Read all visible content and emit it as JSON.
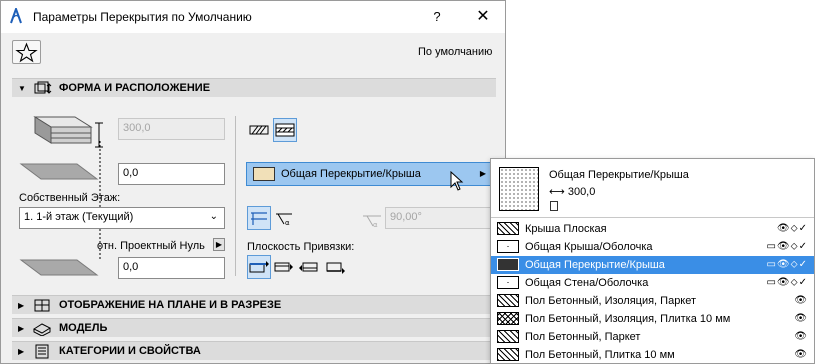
{
  "window": {
    "title": "Параметры Перекрытия по Умолчанию",
    "help_label": "?",
    "close_label": "✕"
  },
  "toolbar": {
    "favorites_icon": "star-icon",
    "default_label": "По умолчанию"
  },
  "sections": {
    "shape": {
      "title": "ФОРМА И РАСПОЛОЖЕНИЕ",
      "expanded": true
    },
    "floorplan": {
      "title": "ОТОБРАЖЕНИЕ НА ПЛАНЕ И В РАЗРЕЗЕ",
      "expanded": false
    },
    "model": {
      "title": "МОДЕЛЬ",
      "expanded": false
    },
    "categories": {
      "title": "КАТЕГОРИИ И СВОЙСТВА",
      "expanded": false
    }
  },
  "geometry": {
    "thickness_value": "300,0",
    "offset_value": "0,0",
    "home_story_label": "Собственный Этаж:",
    "home_story_value": "1. 1-й этаж (Текущий)",
    "project_zero_label": "отн. Проектный Нуль",
    "project_zero_value": "0,0",
    "angle_value": "90,00°",
    "ref_plane_label": "Плоскость Привязки:"
  },
  "composite": {
    "selected": "Общая Перекрытие/Крыша",
    "swatch_color": "#f1e0b8"
  },
  "dropdown": {
    "preview_name": "Общая Перекрытие/Крыша",
    "preview_thickness": "300,0",
    "items": [
      {
        "name": "Крыша Плоская",
        "flags": "👁⬦✓",
        "pattern": "diag",
        "selected": false
      },
      {
        "name": "Общая Крыша/Оболочка",
        "flags": "▭👁⬦✓",
        "pattern": "dots",
        "selected": false
      },
      {
        "name": "Общая Перекрытие/Крыша",
        "flags": "▭👁⬦✓",
        "pattern": "dark",
        "selected": true
      },
      {
        "name": "Общая Стена/Оболочка",
        "flags": "▭👁⬦✓",
        "pattern": "dots",
        "selected": false
      },
      {
        "name": "Пол Бетонный, Изоляция, Паркет",
        "flags": "👁",
        "pattern": "diag",
        "selected": false
      },
      {
        "name": "Пол Бетонный, Изоляция, Плитка 10 мм",
        "flags": "👁",
        "pattern": "cross",
        "selected": false
      },
      {
        "name": "Пол Бетонный, Паркет",
        "flags": "👁",
        "pattern": "diag",
        "selected": false
      },
      {
        "name": "Пол Бетонный, Плитка 10 мм",
        "flags": "👁",
        "pattern": "diag",
        "selected": false
      }
    ]
  },
  "colors": {
    "accent": "#3a8ee6",
    "composite_bg": "#9cc7f0",
    "header_bg": "#dcdcdc"
  }
}
